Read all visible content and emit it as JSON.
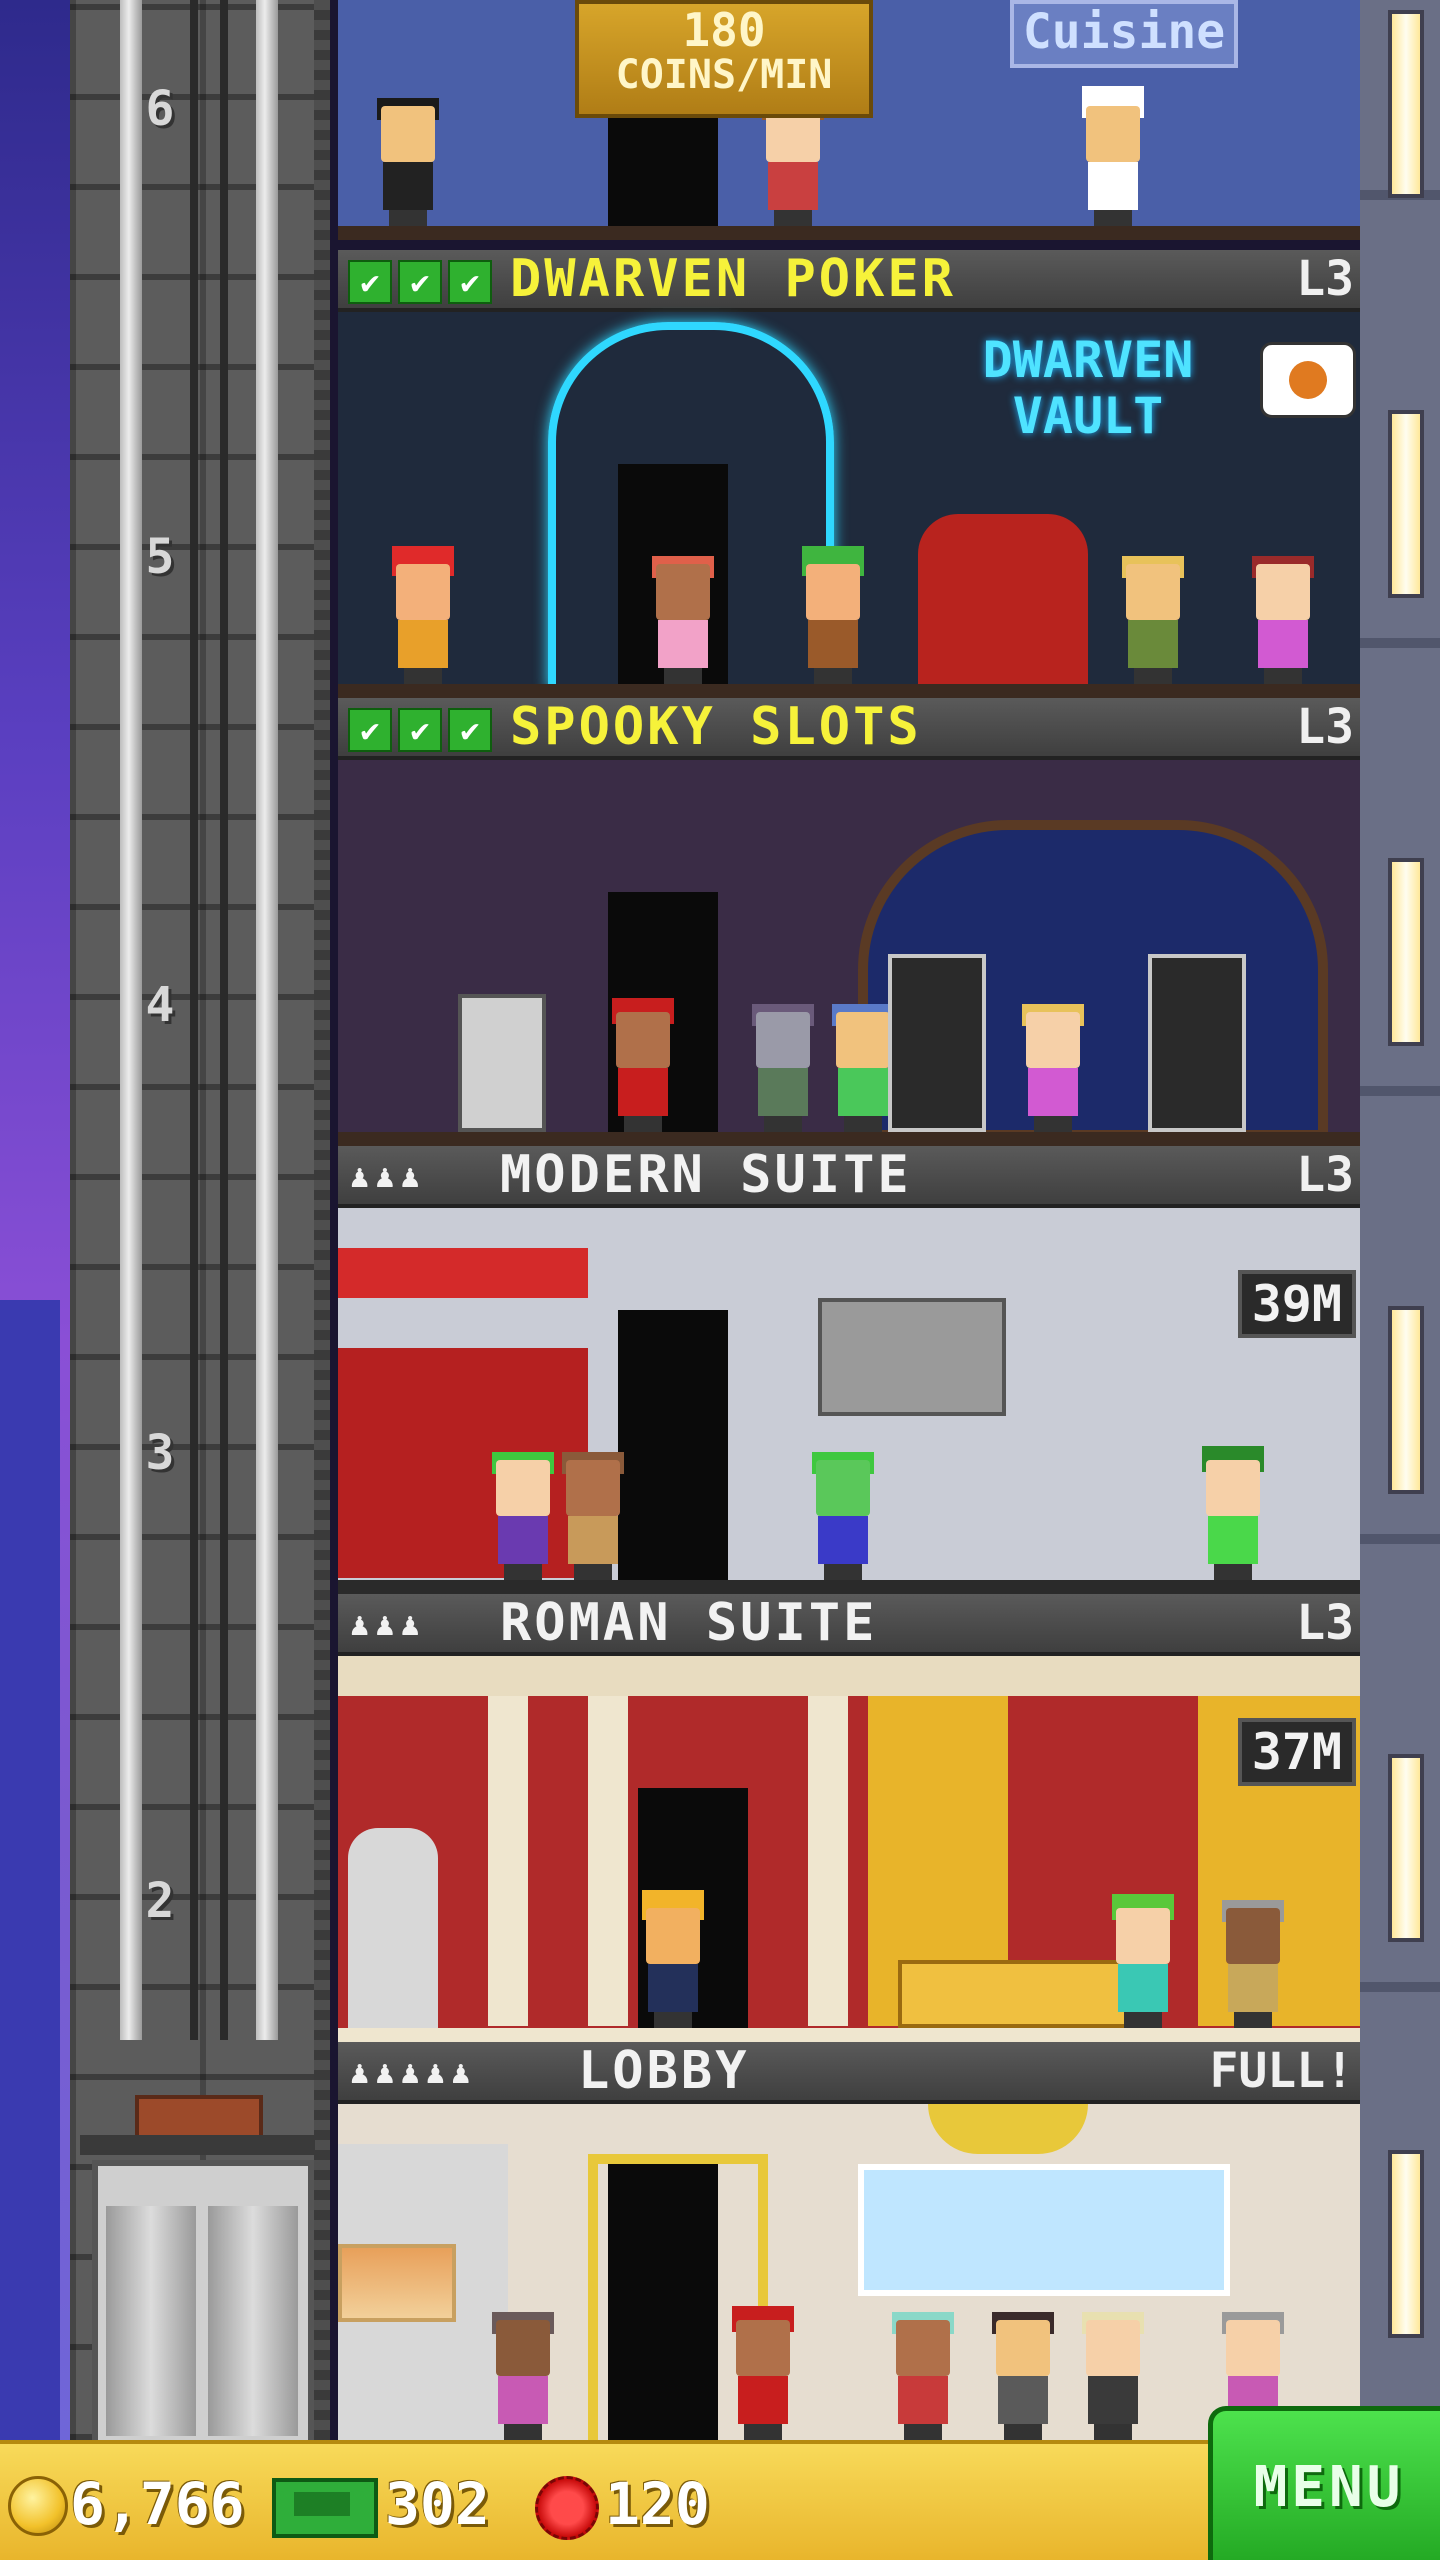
{
  "top_sign": {
    "rate_value": "180",
    "rate_unit": "COINS/MIN",
    "restaurant_sign": "Cuisine"
  },
  "shaft_floors": [
    "6",
    "5",
    "4",
    "3",
    "2"
  ],
  "floors": [
    {
      "name": "DWARVEN POKER",
      "level": "L3",
      "checks": 3,
      "name_color": "#f6f23a",
      "sign_text_1": "DWARVEN",
      "sign_text_2": "VAULT"
    },
    {
      "name": "SPOOKY SLOTS",
      "level": "L3",
      "checks": 3,
      "name_color": "#f6f23a"
    },
    {
      "name": "MODERN SUITE",
      "level": "L3",
      "residents_icon": "♟♟♟",
      "timer": "39M",
      "name_color": "#f2f2f2"
    },
    {
      "name": "ROMAN SUITE",
      "level": "L3",
      "residents_icon": "♟♟♟",
      "timer": "37M",
      "name_color": "#f2f2f2"
    },
    {
      "name": "LOBBY",
      "level": "FULL!",
      "residents_icon": "♟♟♟♟♟",
      "name_color": "#f2f2f2"
    }
  ],
  "bottom_bar": {
    "coins": "6,766",
    "bux": "302",
    "tickets": "120",
    "menu_label": "MENU"
  },
  "icons": {
    "coin": "coin-icon",
    "bux": "tower-bux-icon",
    "ticket": "ticket-icon",
    "check": "check-icon",
    "resident": "resident-icon"
  }
}
